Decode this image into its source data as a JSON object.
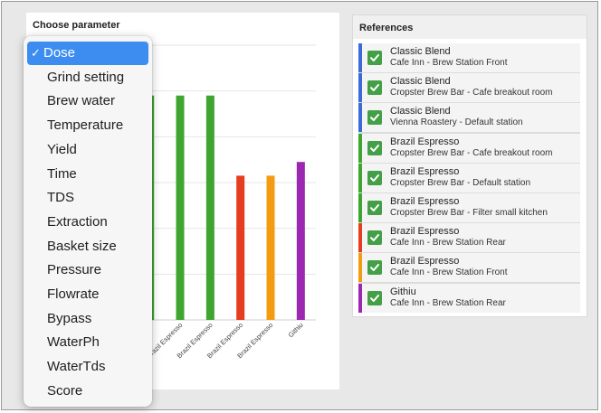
{
  "parameter_picker": {
    "label": "Choose parameter",
    "options": [
      "Dose",
      "Grind setting",
      "Brew water",
      "Temperature",
      "Yield",
      "Time",
      "TDS",
      "Extraction",
      "Basket size",
      "Pressure",
      "Flowrate",
      "Bypass",
      "WaterPh",
      "WaterTds",
      "Score"
    ],
    "selected_index": 0,
    "check_glyph": "✓"
  },
  "chart_data": {
    "type": "bar",
    "categories": [
      "Classic Blend",
      "Classic Blend",
      "Classic Blend",
      "Brazil Espresso",
      "Brazil Espresso",
      "Brazil Espresso",
      "Brazil Espresso",
      "Brazil Espresso",
      "Githiu"
    ],
    "visible_tick_labels": [
      "spresso",
      "Brazil Espresso",
      "Brazil Espresso",
      "Brazil Espresso",
      "Brazil Espresso",
      "Githiu"
    ],
    "visible_values": [
      49,
      49,
      49,
      31.5,
      31.5,
      34.5
    ],
    "visible_colors": [
      "#3ea62f",
      "#3ea62f",
      "#3ea62f",
      "#e53d1e",
      "#f39c12",
      "#9c27b0"
    ],
    "ylim": [
      0,
      60
    ],
    "grid": true
  },
  "references": {
    "title": "References",
    "items": [
      {
        "name": "Classic Blend",
        "location": "Cafe Inn - Brew Station Front",
        "color": "#3a6bd6",
        "checked": true
      },
      {
        "name": "Classic Blend",
        "location": "Cropster Brew Bar - Cafe breakout room",
        "color": "#3a6bd6",
        "checked": true
      },
      {
        "name": "Classic Blend",
        "location": "Vienna Roastery - Default station",
        "color": "#3a6bd6",
        "checked": true
      },
      {
        "name": "Brazil Espresso",
        "location": "Cropster Brew Bar - Cafe breakout room",
        "color": "#3ea62f",
        "checked": true
      },
      {
        "name": "Brazil Espresso",
        "location": "Cropster Brew Bar - Default station",
        "color": "#3ea62f",
        "checked": true
      },
      {
        "name": "Brazil Espresso",
        "location": "Cropster Brew Bar - Filter small kitchen",
        "color": "#3ea62f",
        "checked": true
      },
      {
        "name": "Brazil Espresso",
        "location": "Cafe Inn - Brew Station Rear",
        "color": "#e53d1e",
        "checked": true
      },
      {
        "name": "Brazil Espresso",
        "location": "Cafe Inn - Brew Station Front",
        "color": "#f39c12",
        "checked": true
      },
      {
        "name": "Githiu",
        "location": "Cafe Inn - Brew Station Rear",
        "color": "#9c27b0",
        "checked": true
      }
    ]
  }
}
